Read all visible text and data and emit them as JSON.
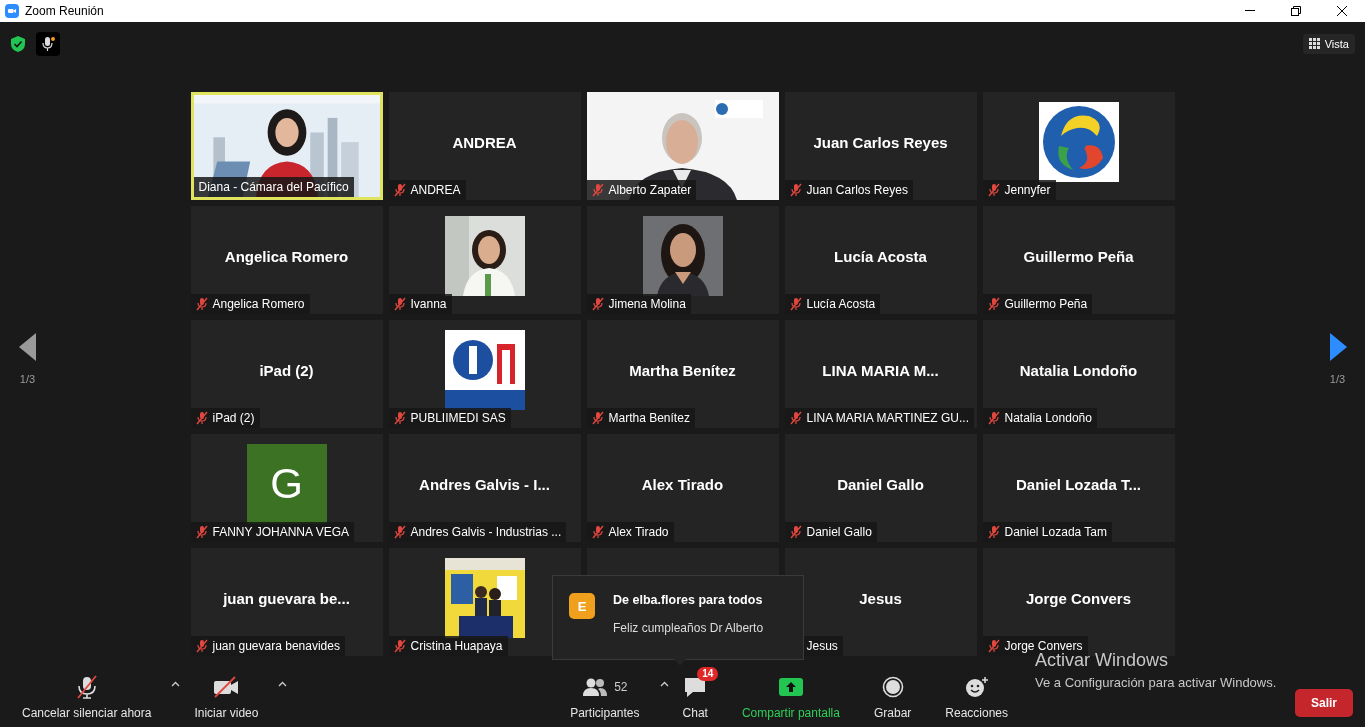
{
  "window": {
    "title": "Zoom Reunión"
  },
  "top_bar": {
    "view_button": "Vista"
  },
  "pager": {
    "left": "1/3",
    "right": "1/3"
  },
  "tiles": [
    {
      "kind": "video",
      "label": "Diana - Cámara del Pacífico",
      "muted": false,
      "speaking": true
    },
    {
      "kind": "name",
      "display_name": "ANDREA",
      "label": "ANDREA",
      "muted": true,
      "speaking": false
    },
    {
      "kind": "video",
      "label": "Alberto Zapater",
      "muted": true,
      "speaking": false
    },
    {
      "kind": "name",
      "display_name": "Juan Carlos Reyes",
      "label": "Juan Carlos Reyes",
      "muted": true,
      "speaking": false
    },
    {
      "kind": "emblem",
      "label": "Jennyfer",
      "muted": true,
      "speaking": false
    },
    {
      "kind": "name",
      "display_name": "Angelica Romero",
      "label": "Angelica Romero",
      "muted": true,
      "speaking": false
    },
    {
      "label": "Ivanna",
      "muted": true,
      "speaking": false
    },
    {
      "label": "Jimena Molina",
      "muted": true,
      "speaking": false
    },
    {
      "kind": "name",
      "display_name": "Lucía Acosta",
      "label": "Lucía Acosta",
      "muted": true,
      "speaking": false
    },
    {
      "kind": "name",
      "display_name": "Guillermo Peña",
      "label": "Guillermo Peña",
      "muted": true,
      "speaking": false
    },
    {
      "kind": "name",
      "display_name": "iPad (2)",
      "label": "iPad (2)",
      "muted": true,
      "speaking": false
    },
    {
      "kind": "brand",
      "label": "PUBLIIMEDI SAS",
      "muted": true,
      "speaking": false
    },
    {
      "kind": "name",
      "display_name": "Martha Benítez",
      "label": "Martha Benítez",
      "muted": true,
      "speaking": false
    },
    {
      "kind": "name",
      "display_name": "LINA MARIA M...",
      "label": "LINA MARIA MARTINEZ GU...",
      "muted": true,
      "speaking": false
    },
    {
      "kind": "name",
      "display_name": "Natalia Londoño",
      "label": "Natalia Londoño",
      "muted": true,
      "speaking": false
    },
    {
      "kind": "letter",
      "letter": "G",
      "label": "FANNY JOHANNA VEGA",
      "muted": true,
      "speaking": false
    },
    {
      "kind": "name",
      "display_name": "Andres Galvis - I...",
      "label": "Andres Galvis - Industrias ...",
      "muted": true,
      "speaking": false
    },
    {
      "kind": "name",
      "display_name": "Alex Tirado",
      "label": "Alex Tirado",
      "muted": true,
      "speaking": false
    },
    {
      "kind": "name",
      "display_name": "Daniel Gallo",
      "label": "Daniel Gallo",
      "muted": true,
      "speaking": false
    },
    {
      "kind": "name",
      "display_name": "Daniel Lozada T...",
      "label": "Daniel Lozada Tam",
      "muted": true,
      "speaking": false
    },
    {
      "kind": "name",
      "display_name": "juan guevara be...",
      "label": "juan guevara benavides",
      "muted": true,
      "speaking": false
    },
    {
      "label": "Cristina Huapaya",
      "muted": true,
      "speaking": false
    },
    {
      "kind": "covered"
    },
    {
      "kind": "name",
      "display_name": "Jesus",
      "label": "Jesus",
      "speaking": false
    },
    {
      "kind": "name",
      "display_name": "Jorge Convers",
      "label": "Jorge Convers",
      "muted": true,
      "speaking": false
    }
  ],
  "chat_notification": {
    "avatar": "E",
    "title": "De elba.flores para todos",
    "message": "Feliz cumpleaños Dr Alberto"
  },
  "toolbar": {
    "left_items": [
      {
        "kind": "mic",
        "label": "Cancelar silenciar ahora",
        "caret": true
      },
      {
        "kind": "video",
        "label": "Iniciar video",
        "caret": true
      }
    ],
    "center_items": [
      {
        "kind": "participants",
        "label": "Participantes",
        "count": "52",
        "caret": true
      },
      {
        "kind": "chat",
        "label": "Chat",
        "badge": "14",
        "caret": false
      },
      {
        "kind": "share",
        "label": "Compartir pantalla",
        "caret": false
      },
      {
        "kind": "record",
        "label": "Grabar",
        "caret": false
      },
      {
        "kind": "reactions",
        "label": "Reacciones",
        "caret": false
      }
    ],
    "leave": "Salir"
  },
  "os_notice": {
    "title": "Activar Windows",
    "message": "Ve a Configuración para activar Windows."
  }
}
